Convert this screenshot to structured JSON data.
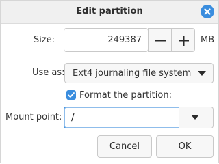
{
  "window": {
    "title": "Edit partition",
    "accent_color": "#3a8dde"
  },
  "size": {
    "label": "Size:",
    "value": "249387",
    "unit": "MB",
    "decrement_icon": "minus-icon",
    "increment_icon": "plus-icon"
  },
  "use_as": {
    "label": "Use as:",
    "selected": "Ext4 journaling file system"
  },
  "format": {
    "label": "Format the partition:",
    "checked": true
  },
  "mount_point": {
    "label": "Mount point:",
    "value": "/"
  },
  "buttons": {
    "cancel": "Cancel",
    "ok": "OK"
  }
}
